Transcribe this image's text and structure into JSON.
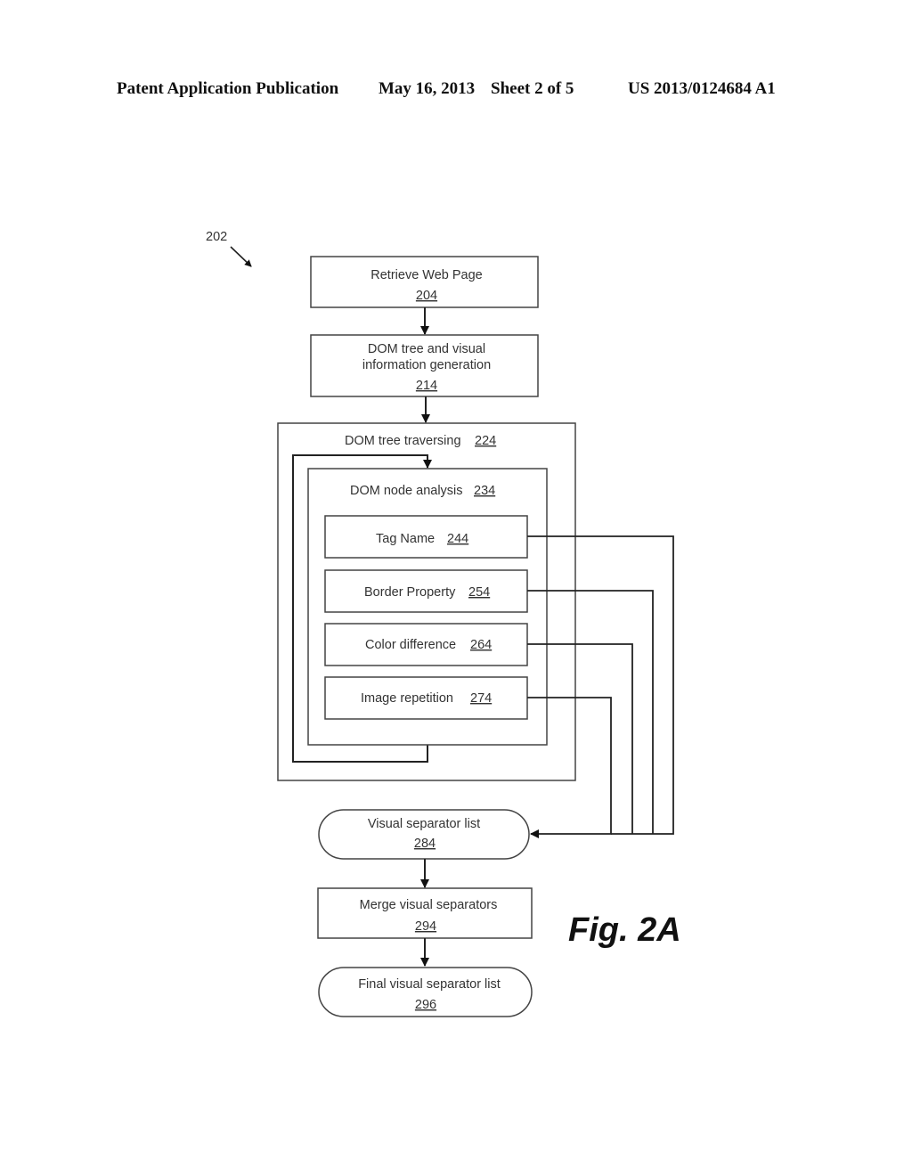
{
  "header": {
    "publication": "Patent Application Publication",
    "date": "May 16, 2013",
    "sheet": "Sheet 2 of 5",
    "number": "US 2013/0124684 A1"
  },
  "figure": {
    "ref": "202",
    "caption": "Fig. 2A",
    "nodes": {
      "retrieve": {
        "label": "Retrieve Web Page",
        "ref": "204"
      },
      "dom_gen": {
        "label1": "DOM tree and visual",
        "label2": "information generation",
        "ref": "214"
      },
      "traverse": {
        "label": "DOM tree traversing",
        "ref": "224"
      },
      "node_analysis": {
        "label": "DOM node analysis",
        "ref": "234"
      },
      "tag_name": {
        "label": "Tag Name",
        "ref": "244"
      },
      "border": {
        "label": "Border Property",
        "ref": "254"
      },
      "color": {
        "label": "Color difference",
        "ref": "264"
      },
      "image_rep": {
        "label": "Image repetition",
        "ref": "274"
      },
      "vs_list": {
        "label": "Visual separator list",
        "ref": "284"
      },
      "merge": {
        "label": "Merge visual separators",
        "ref": "294"
      },
      "final": {
        "label": "Final visual separator list",
        "ref": "296"
      }
    }
  }
}
